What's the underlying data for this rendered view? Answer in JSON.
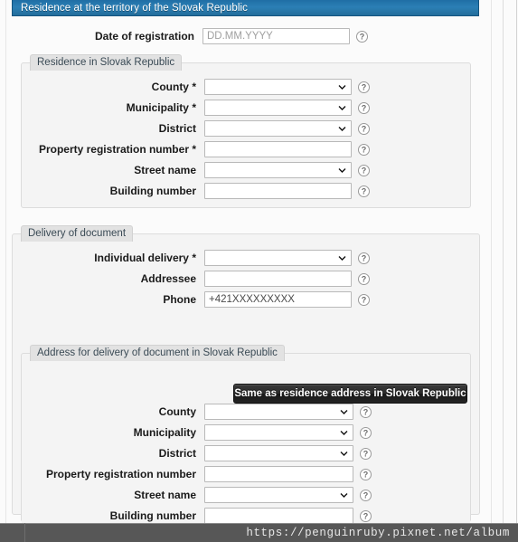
{
  "header": {
    "title": "Residence at the territory of the Slovak Republic"
  },
  "top_field": {
    "label": "Date of registration",
    "placeholder": "DD.MM.YYYY",
    "value": "",
    "help_icon": "help-question-icon"
  },
  "residence_section": {
    "legend": "Residence in Slovak Republic",
    "rows": [
      {
        "label": "County",
        "required": "*",
        "type": "select",
        "value": "",
        "help_icon": "help-question-icon"
      },
      {
        "label": "Municipality",
        "required": "*",
        "type": "select",
        "value": "",
        "help_icon": "help-question-icon"
      },
      {
        "label": "District",
        "required": "",
        "type": "select",
        "value": "",
        "help_icon": "help-question-icon"
      },
      {
        "label": "Property registration number",
        "required": "*",
        "type": "text",
        "value": "",
        "help_icon": "help-question-icon"
      },
      {
        "label": "Street name",
        "required": "",
        "type": "select",
        "value": "",
        "help_icon": "help-question-icon"
      },
      {
        "label": "Building number",
        "required": "",
        "type": "text",
        "value": "",
        "help_icon": "help-question-icon"
      }
    ]
  },
  "delivery_section": {
    "legend": "Delivery of document",
    "rows": [
      {
        "label": "Individual delivery",
        "required": "*",
        "type": "select",
        "value": "",
        "help_icon": "help-question-icon"
      },
      {
        "label": "Addressee",
        "required": "",
        "type": "text",
        "value": "",
        "help_icon": "help-question-icon"
      },
      {
        "label": "Phone",
        "required": "",
        "type": "text",
        "value": "+421XXXXXXXXX",
        "help_icon": "help-question-icon"
      }
    ],
    "address_subsection": {
      "legend": "Address for delivery of document in Slovak Republic",
      "copy_button": "Same as residence address in Slovak Republic",
      "rows": [
        {
          "label": "County",
          "required": "",
          "type": "select",
          "value": "",
          "help_icon": "help-question-icon"
        },
        {
          "label": "Municipality",
          "required": "",
          "type": "select",
          "value": "",
          "help_icon": "help-question-icon"
        },
        {
          "label": "District",
          "required": "",
          "type": "select",
          "value": "",
          "help_icon": "help-question-icon"
        },
        {
          "label": "Property registration number",
          "required": "",
          "type": "text",
          "value": "",
          "help_icon": "help-question-icon"
        },
        {
          "label": "Street name",
          "required": "",
          "type": "select",
          "value": "",
          "help_icon": "help-question-icon"
        },
        {
          "label": "Building number",
          "required": "",
          "type": "text",
          "value": "",
          "help_icon": "help-question-icon"
        }
      ]
    }
  },
  "footer": {
    "watermark": "https://penguinruby.pixnet.net/album"
  },
  "colors": {
    "header_blue": "#2b7fb5",
    "header_blue_dark": "#14547f",
    "fieldset_bg": "#f4f4f4",
    "legend_bg": "#e2e2e2",
    "button_dark": "#242424",
    "footer_bar": "#575757",
    "field_border": "#b9b9b9"
  }
}
